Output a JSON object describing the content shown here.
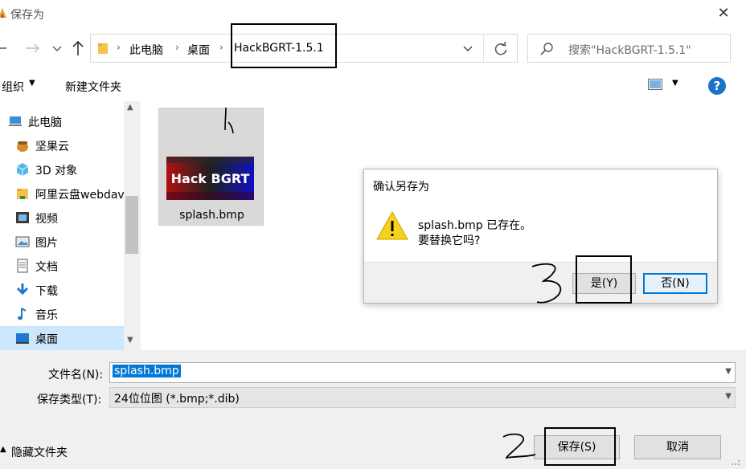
{
  "window": {
    "title": "保存为",
    "close_glyph": "✕"
  },
  "address": {
    "crumbs": [
      "此电脑",
      "桌面",
      "HackBGRT-1.5.1"
    ],
    "search_placeholder": "搜索\"HackBGRT-1.5.1\""
  },
  "toolbar": {
    "organize": "组织",
    "new_folder": "新建文件夹"
  },
  "nav": {
    "items": [
      {
        "label": "此电脑",
        "icon": "computer-icon"
      },
      {
        "label": "坚果云",
        "icon": "nutstore-icon"
      },
      {
        "label": "3D 对象",
        "icon": "3d-objects-icon"
      },
      {
        "label": "阿里云盘webdav",
        "icon": "aliyun-drive-icon"
      },
      {
        "label": "视频",
        "icon": "video-icon"
      },
      {
        "label": "图片",
        "icon": "pictures-icon"
      },
      {
        "label": "文档",
        "icon": "documents-icon"
      },
      {
        "label": "下载",
        "icon": "download-icon"
      },
      {
        "label": "音乐",
        "icon": "music-icon"
      },
      {
        "label": "桌面",
        "icon": "desktop-icon"
      }
    ],
    "selected": "桌面"
  },
  "content": {
    "files": [
      {
        "name": "splash.bmp",
        "thumb_text": "Hack BGRT"
      }
    ]
  },
  "form": {
    "filename_label": "文件名(N):",
    "filename_value": "splash.bmp",
    "filetype_label": "保存类型(T):",
    "filetype_value": "24位位图 (*.bmp;*.dib)",
    "hide_folders": "隐藏文件夹",
    "save": "保存(S)",
    "cancel": "取消"
  },
  "dialog": {
    "title": "确认另存为",
    "message_line1": "splash.bmp 已存在。",
    "message_line2": "要替换它吗?",
    "yes": "是(Y)",
    "no": "否(N)"
  },
  "annotations": {
    "marks": [
      "1",
      "2",
      "3"
    ]
  },
  "colors": {
    "accent": "#0078d7",
    "selected_bg": "#cce8ff",
    "warning": "#f7d21c"
  }
}
